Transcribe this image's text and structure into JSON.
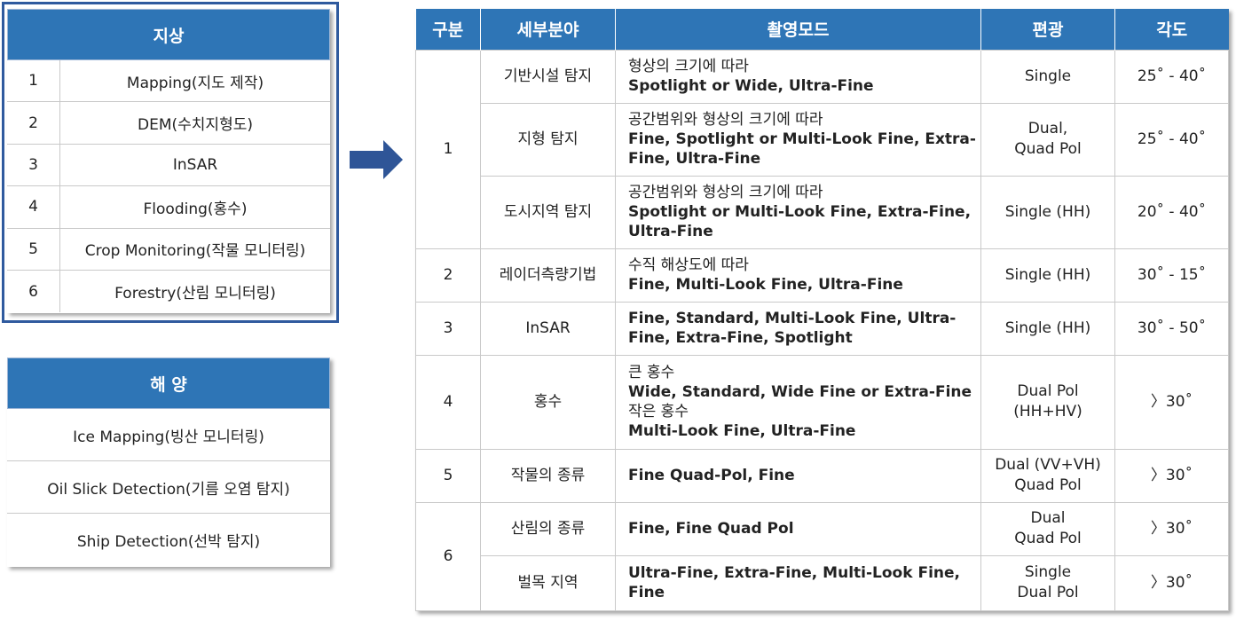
{
  "ground": {
    "title": "지상",
    "rows": [
      {
        "num": "1",
        "label": "Mapping(지도 제작)"
      },
      {
        "num": "2",
        "label": "DEM(수치지형도)"
      },
      {
        "num": "3",
        "label": "InSAR"
      },
      {
        "num": "4",
        "label": "Flooding(홍수)"
      },
      {
        "num": "5",
        "label": "Crop Monitoring(작물 모니터링)"
      },
      {
        "num": "6",
        "label": "Forestry(산림 모니터링)"
      }
    ]
  },
  "ocean": {
    "title": "해 양",
    "rows": [
      "Ice Mapping(빙산 모니터링)",
      "Oil Slick Detection(기름 오염 탐지)",
      "Ship Detection(선박 탐지)"
    ]
  },
  "table": {
    "headers": [
      "구분",
      "세부분야",
      "촬영모드",
      "편광",
      "각도"
    ],
    "rows": [
      {
        "group": "1",
        "field": "기반시설 탐지",
        "mode": [
          "형상의 크기에 따라",
          "Spotlight or Wide, Ultra-Fine"
        ],
        "pol": [
          "Single"
        ],
        "angle": "25˚ - 40˚"
      },
      {
        "field": "지형 탐지",
        "mode": [
          "공간범위와 형상의 크기에 따라",
          "Fine, Spotlight or Multi-Look Fine, Extra-Fine, Ultra-Fine"
        ],
        "pol": [
          "Dual,",
          "Quad Pol"
        ],
        "angle": "25˚ - 40˚"
      },
      {
        "field": "도시지역 탐지",
        "mode": [
          "공간범위와 형상의 크기에 따라",
          "Spotlight or Multi-Look Fine, Extra-Fine, Ultra-Fine"
        ],
        "pol": [
          "Single (HH)"
        ],
        "angle": "20˚ - 40˚"
      },
      {
        "group": "2",
        "field": "레이더측량기법",
        "mode": [
          "수직 해상도에 따라",
          "Fine, Multi-Look Fine, Ultra-Fine"
        ],
        "pol": [
          "Single (HH)"
        ],
        "angle": "30˚ - 15˚"
      },
      {
        "group": "3",
        "field": "InSAR",
        "mode": [
          "",
          "Fine, Standard, Multi-Look Fine, Ultra-Fine, Extra-Fine, Spotlight"
        ],
        "pol": [
          "Single (HH)"
        ],
        "angle": "30˚ - 50˚"
      },
      {
        "group": "4",
        "field": "홍수",
        "mode": [
          "큰 홍수",
          "Wide, Standard, Wide Fine or Extra-Fine",
          "작은 홍수",
          "Multi-Look Fine, Ultra-Fine"
        ],
        "pol": [
          "Dual Pol",
          "(HH+HV)"
        ],
        "angle": "〉30˚"
      },
      {
        "group": "5",
        "field": "작물의 종류",
        "mode": [
          "",
          "Fine Quad-Pol, Fine"
        ],
        "pol": [
          "Dual (VV+VH)",
          "Quad Pol"
        ],
        "angle": "〉30˚"
      },
      {
        "group": "6",
        "field": "산림의 종류",
        "mode": [
          "",
          "Fine, Fine Quad Pol"
        ],
        "pol": [
          "Dual",
          "Quad Pol"
        ],
        "angle": "〉30˚"
      },
      {
        "field": "벌목 지역",
        "mode": [
          "",
          "Ultra-Fine, Extra-Fine, Multi-Look Fine, Fine"
        ],
        "pol": [
          "Single",
          "Dual Pol"
        ],
        "angle": "〉30˚"
      }
    ]
  },
  "colors": {
    "header_bg": "#2e75b6",
    "frame": "#2f5a9e",
    "arrow": "#2f5597"
  },
  "icons": {
    "arrow": "right-arrow-icon"
  }
}
